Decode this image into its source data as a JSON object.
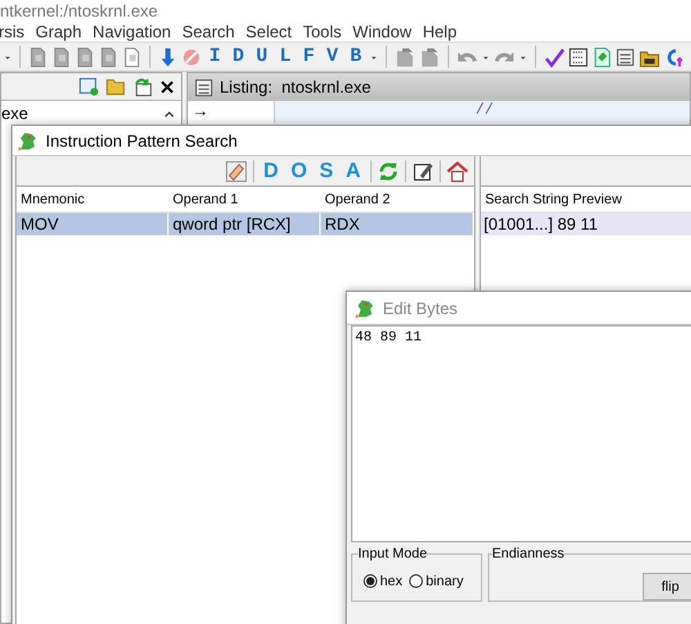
{
  "window": {
    "title": "ntkernel:/ntoskrnl.exe"
  },
  "menu": [
    "rsis",
    "Graph",
    "Navigation",
    "Search",
    "Select",
    "Tools",
    "Window",
    "Help"
  ],
  "toolbar": {
    "letter_buttons": [
      "I",
      "D",
      "U",
      "L",
      "F",
      "V",
      "B"
    ]
  },
  "program_tree": {
    "items": [
      "exe"
    ]
  },
  "listing": {
    "tab": "Listing:  ntoskrnl.exe",
    "arrow": "→",
    "comment": "//"
  },
  "pattern_search": {
    "title": "Instruction Pattern Search",
    "letter_buttons": [
      "D",
      "O",
      "S",
      "A"
    ],
    "columns": [
      "Mnemonic",
      "Operand 1",
      "Operand 2"
    ],
    "rows": [
      {
        "cells": [
          "MOV",
          "qword ptr [RCX]",
          "RDX"
        ],
        "selected": true
      }
    ],
    "preview": {
      "column": "Search String Preview",
      "rows": [
        "[01001...] 89 11"
      ]
    }
  },
  "edit_bytes": {
    "title": "Edit Bytes",
    "text": "48 89 11",
    "input_mode": {
      "label": "Input Mode",
      "options": [
        {
          "label": "hex",
          "selected": true
        },
        {
          "label": "binary",
          "selected": false
        }
      ]
    },
    "endianness": {
      "label": "Endianness",
      "button": "flip"
    }
  }
}
